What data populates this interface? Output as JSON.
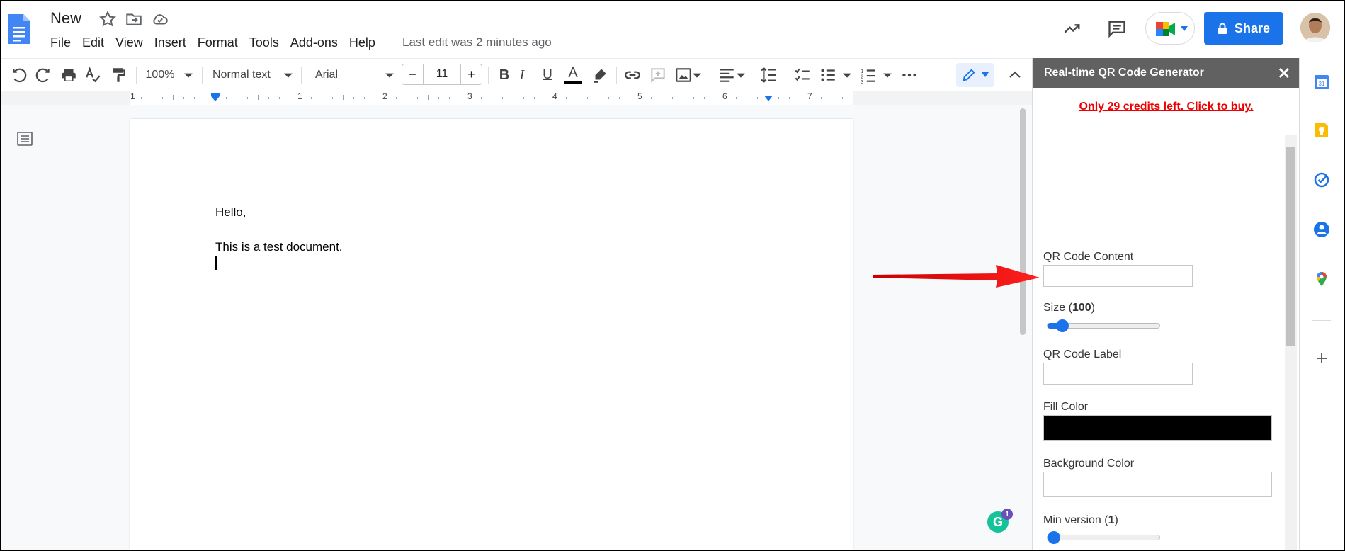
{
  "header": {
    "doc_title": "New",
    "menu": [
      "File",
      "Edit",
      "View",
      "Insert",
      "Format",
      "Tools",
      "Add-ons",
      "Help"
    ],
    "last_edit": "Last edit was 2 minutes ago",
    "share_label": "Share"
  },
  "toolbar": {
    "zoom": "100%",
    "style": "Normal text",
    "font": "Arial",
    "font_size": "11",
    "minus": "−",
    "plus": "+",
    "bold": "B",
    "italic": "I",
    "underline": "U",
    "text_color": "A"
  },
  "ruler": {
    "numbers": [
      "1",
      "1",
      "2",
      "3",
      "4",
      "5",
      "6",
      "7"
    ]
  },
  "document": {
    "lines": [
      "Hello,",
      "This is a test document."
    ]
  },
  "grammarly": {
    "letter": "G",
    "badge": "1"
  },
  "addon": {
    "title": "Real-time QR Code Generator",
    "close": "✕",
    "credits": "Only 29 credits left. Click to buy.",
    "qr_content_label": "QR Code Content",
    "qr_content_value": "",
    "size_label_prefix": "Size (",
    "size_value": "100",
    "size_label_suffix": ")",
    "qr_label_label": "QR Code Label",
    "qr_label_value": "",
    "fill_color_label": "Fill Color",
    "fill_color": "#000000",
    "background_color_label": "Background Color",
    "background_color": "#ffffff",
    "min_version_prefix": "Min version (",
    "min_version_value": "1",
    "min_version_suffix": ")",
    "size_slider_fraction": 0.1,
    "min_version_slider_fraction": 0.0
  },
  "colors": {
    "share_blue": "#1a73e8",
    "panel_header": "#616161",
    "credits_red": "#e00000",
    "annotation_arrow": "#e01010"
  },
  "icons": {
    "header": [
      "docs-logo-icon",
      "star-icon",
      "move-to-folder-icon",
      "cloud-saved-icon",
      "activity-trend-icon",
      "comment-icon",
      "meet-icon",
      "lock-icon"
    ],
    "rail": [
      "calendar-icon",
      "keep-icon",
      "tasks-icon",
      "contacts-icon",
      "maps-icon",
      "add-icon"
    ]
  }
}
